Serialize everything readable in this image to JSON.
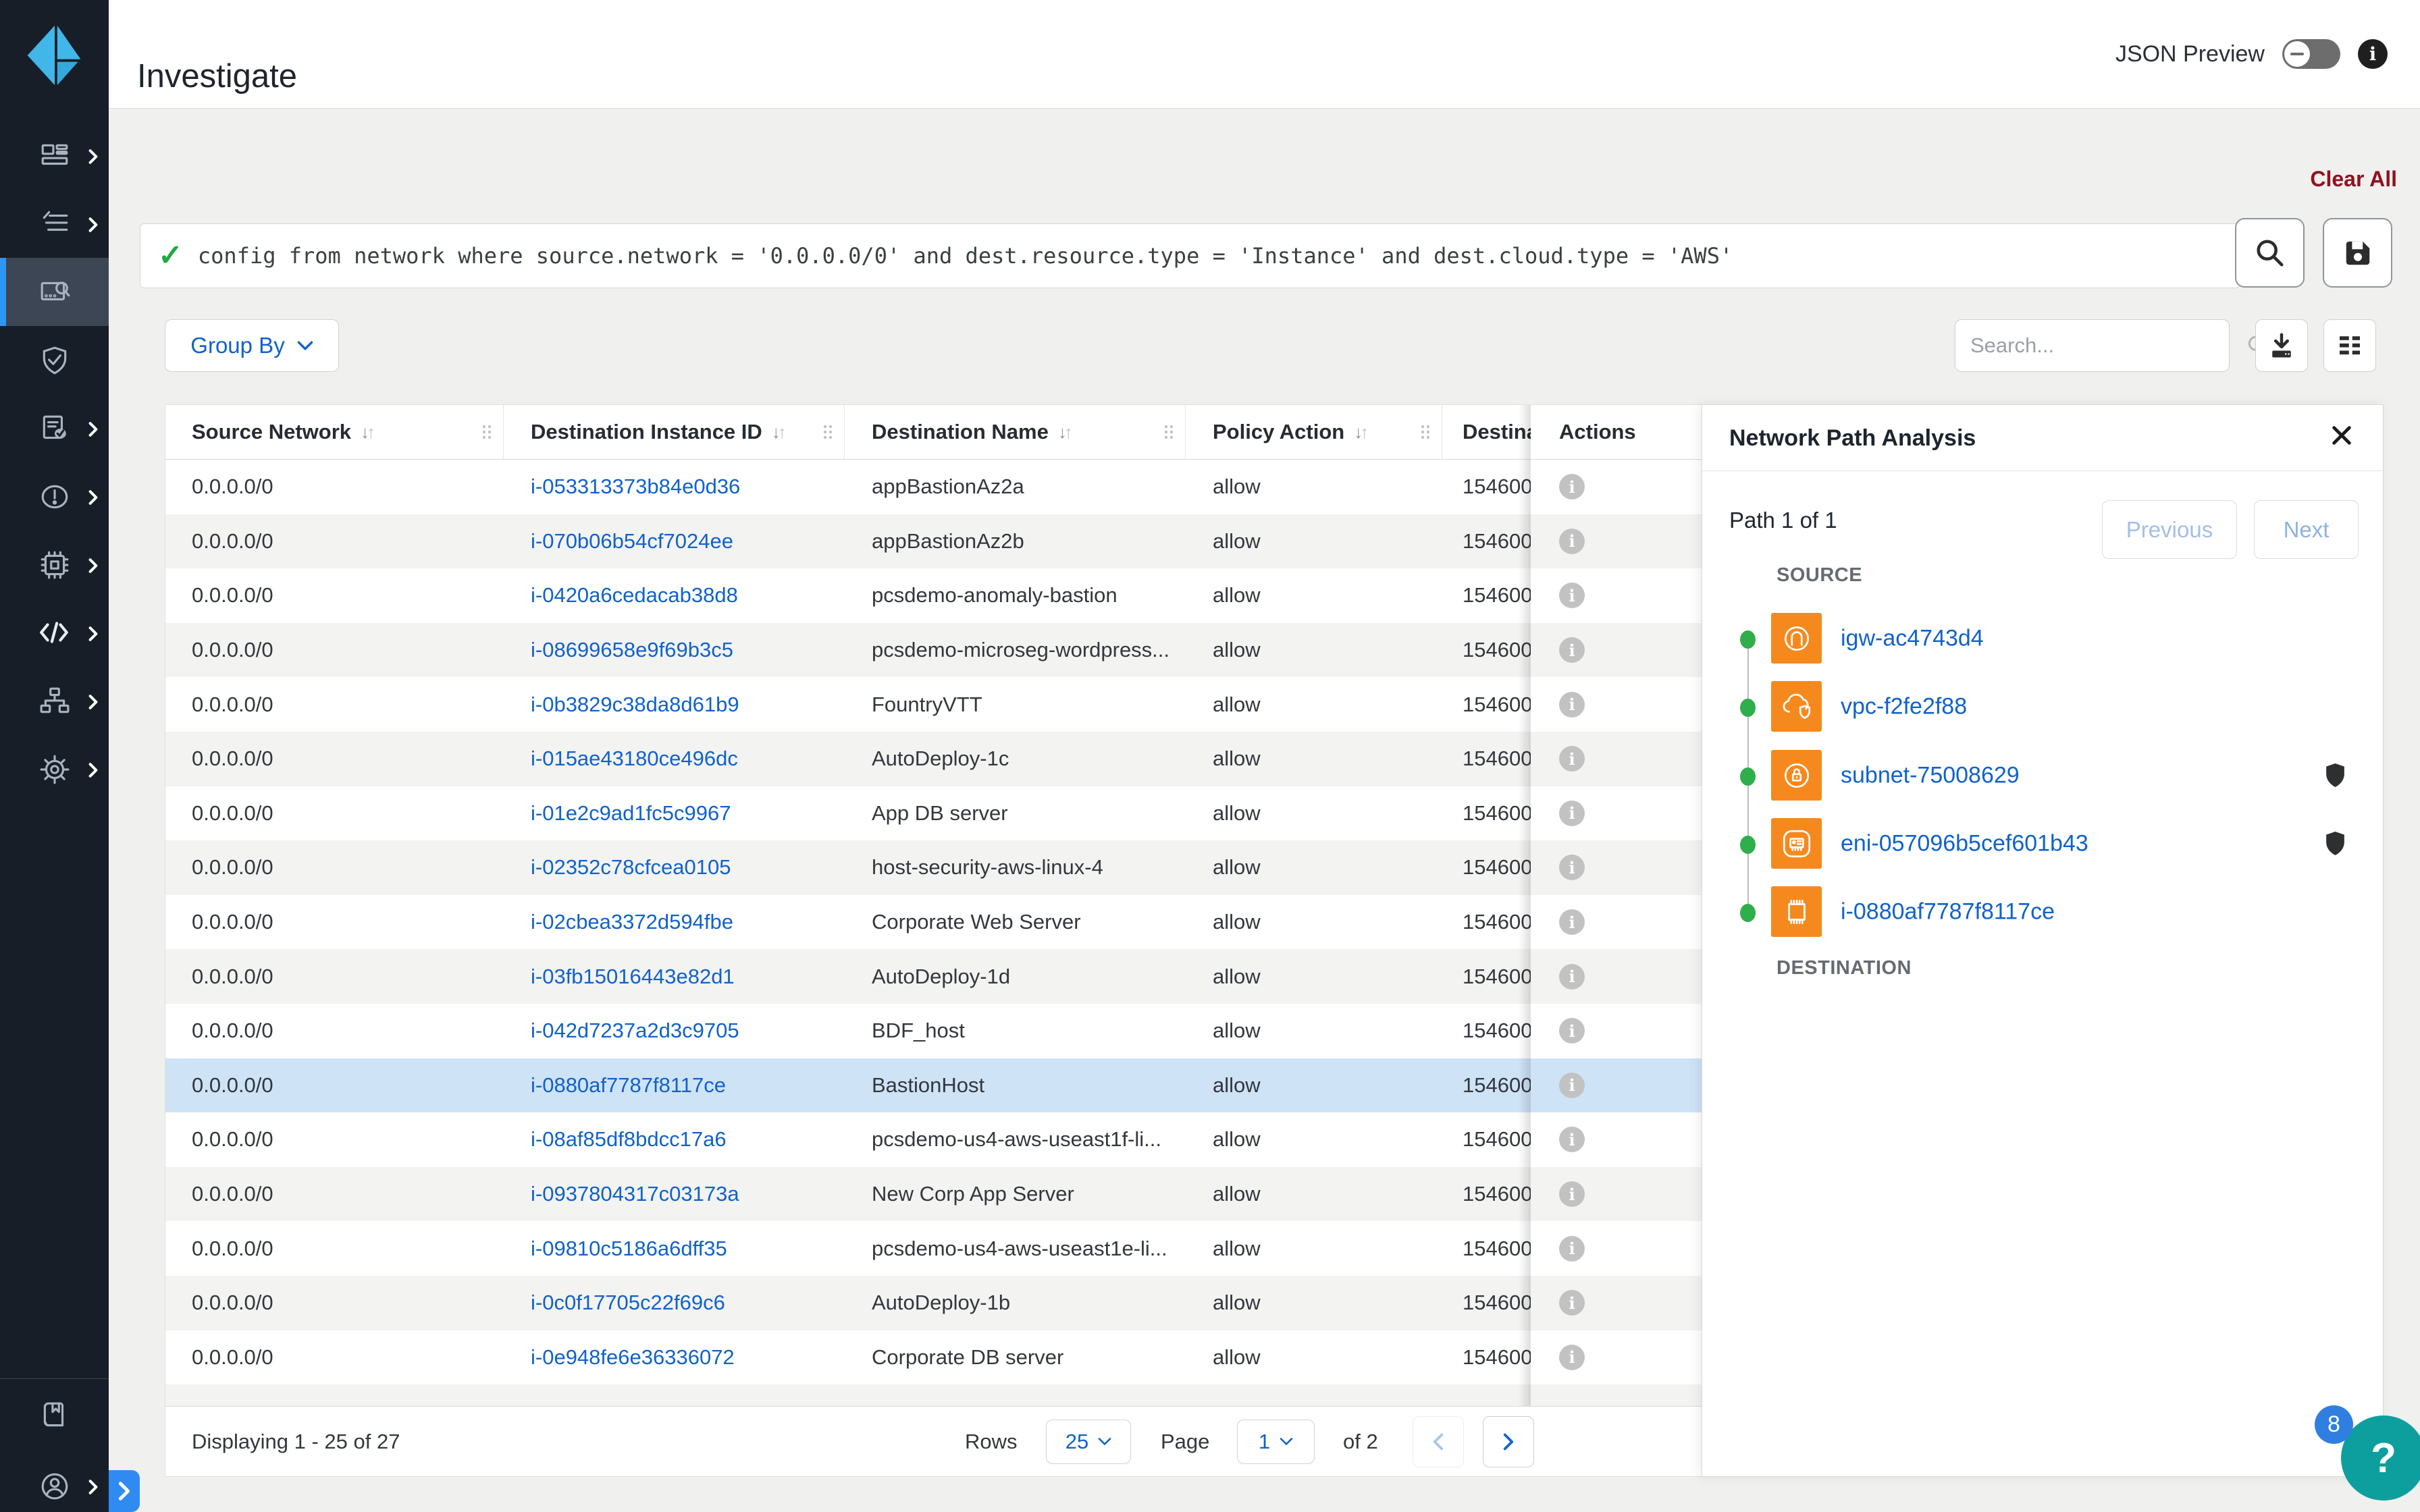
{
  "header": {
    "title": "Investigate",
    "json_preview_label": "JSON Preview"
  },
  "query": {
    "clear_all": "Clear All",
    "text": "config from network where source.network = '0.0.0.0/0' and dest.resource.type = 'Instance' and dest.cloud.type = 'AWS'"
  },
  "toolbar": {
    "group_by_label": "Group By",
    "search_placeholder": "Search..."
  },
  "sidebar": {
    "items": [
      {
        "icon": "dashboard-icon",
        "expandable": true
      },
      {
        "icon": "inventory-list-icon",
        "expandable": true
      },
      {
        "icon": "investigate-icon",
        "expandable": false,
        "selected": true
      },
      {
        "icon": "policies-shield-icon",
        "expandable": false
      },
      {
        "icon": "compliance-report-icon",
        "expandable": true
      },
      {
        "icon": "alerts-icon",
        "expandable": true
      },
      {
        "icon": "compute-chip-icon",
        "expandable": true
      },
      {
        "icon": "code-security-icon",
        "expandable": true
      },
      {
        "icon": "network-topology-icon",
        "expandable": true
      },
      {
        "icon": "settings-gear-icon",
        "expandable": true
      }
    ],
    "bottom_items": [
      {
        "icon": "docs-book-icon"
      },
      {
        "icon": "profile-user-icon",
        "expandable": true
      }
    ]
  },
  "table": {
    "columns": [
      {
        "label": "Source Network"
      },
      {
        "label": "Destination Instance ID"
      },
      {
        "label": "Destination Name"
      },
      {
        "label": "Policy Action"
      },
      {
        "label": "Destina"
      },
      {
        "label": "Actions"
      }
    ],
    "rows": [
      {
        "source": "0.0.0.0/0",
        "instance_id": "i-053313373b84e0d36",
        "name": "appBastionAz2a",
        "action": "allow",
        "dest_extra": "154600"
      },
      {
        "source": "0.0.0.0/0",
        "instance_id": "i-070b06b54cf7024ee",
        "name": "appBastionAz2b",
        "action": "allow",
        "dest_extra": "154600"
      },
      {
        "source": "0.0.0.0/0",
        "instance_id": "i-0420a6cedacab38d8",
        "name": "pcsdemo-anomaly-bastion",
        "action": "allow",
        "dest_extra": "154600"
      },
      {
        "source": "0.0.0.0/0",
        "instance_id": "i-08699658e9f69b3c5",
        "name": "pcsdemo-microseg-wordpress...",
        "action": "allow",
        "dest_extra": "154600"
      },
      {
        "source": "0.0.0.0/0",
        "instance_id": "i-0b3829c38da8d61b9",
        "name": "FountryVTT",
        "action": "allow",
        "dest_extra": "154600"
      },
      {
        "source": "0.0.0.0/0",
        "instance_id": "i-015ae43180ce496dc",
        "name": "AutoDeploy-1c",
        "action": "allow",
        "dest_extra": "154600"
      },
      {
        "source": "0.0.0.0/0",
        "instance_id": "i-01e2c9ad1fc5c9967",
        "name": "App DB server",
        "action": "allow",
        "dest_extra": "154600"
      },
      {
        "source": "0.0.0.0/0",
        "instance_id": "i-02352c78cfcea0105",
        "name": "host-security-aws-linux-4",
        "action": "allow",
        "dest_extra": "154600"
      },
      {
        "source": "0.0.0.0/0",
        "instance_id": "i-02cbea3372d594fbe",
        "name": "Corporate Web Server",
        "action": "allow",
        "dest_extra": "154600"
      },
      {
        "source": "0.0.0.0/0",
        "instance_id": "i-03fb15016443e82d1",
        "name": "AutoDeploy-1d",
        "action": "allow",
        "dest_extra": "154600"
      },
      {
        "source": "0.0.0.0/0",
        "instance_id": "i-042d7237a2d3c9705",
        "name": "BDF_host",
        "action": "allow",
        "dest_extra": "154600"
      },
      {
        "source": "0.0.0.0/0",
        "instance_id": "i-0880af7787f8117ce",
        "name": "BastionHost",
        "action": "allow",
        "dest_extra": "154600",
        "selected": true
      },
      {
        "source": "0.0.0.0/0",
        "instance_id": "i-08af85df8bdcc17a6",
        "name": "pcsdemo-us4-aws-useast1f-li...",
        "action": "allow",
        "dest_extra": "154600"
      },
      {
        "source": "0.0.0.0/0",
        "instance_id": "i-0937804317c03173a",
        "name": "New Corp App Server",
        "action": "allow",
        "dest_extra": "154600"
      },
      {
        "source": "0.0.0.0/0",
        "instance_id": "i-09810c5186a6dff35",
        "name": "pcsdemo-us4-aws-useast1e-li...",
        "action": "allow",
        "dest_extra": "154600"
      },
      {
        "source": "0.0.0.0/0",
        "instance_id": "i-0c0f17705c22f69c6",
        "name": "AutoDeploy-1b",
        "action": "allow",
        "dest_extra": "154600"
      },
      {
        "source": "0.0.0.0/0",
        "instance_id": "i-0e948fe6e36336072",
        "name": "Corporate DB server",
        "action": "allow",
        "dest_extra": "154600"
      }
    ]
  },
  "footer": {
    "displaying": "Displaying 1 - 25 of 27",
    "rows_label": "Rows",
    "rows_value": "25",
    "page_label": "Page",
    "page_value": "1",
    "of_label": "of 2"
  },
  "panel": {
    "title": "Network Path Analysis",
    "path_label": "Path 1 of 1",
    "previous_label": "Previous",
    "next_label": "Next",
    "source_label": "SOURCE",
    "destination_label": "DESTINATION",
    "nodes": [
      {
        "label": "igw-ac4743d4",
        "icon": "internet-gateway-icon",
        "shield": false
      },
      {
        "label": "vpc-f2fe2f88",
        "icon": "vpc-cloud-icon",
        "shield": false
      },
      {
        "label": "subnet-75008629",
        "icon": "subnet-lock-icon",
        "shield": true
      },
      {
        "label": "eni-057096b5cef601b43",
        "icon": "network-interface-icon",
        "shield": true
      },
      {
        "label": "i-0880af7787f8117ce",
        "icon": "instance-chip-icon",
        "shield": false
      }
    ]
  },
  "help": {
    "question_mark": "?",
    "badge": "8"
  },
  "colors": {
    "accent_blue": "#1062cb",
    "selected_row": "#cfe3f7",
    "clear_all_red": "#8e1220",
    "node_orange": "#f6891e",
    "path_dot_green": "#2fae4c",
    "sidebar_bg": "#171e27",
    "sidebar_selected": "#3c4654",
    "sidebar_accent": "#2f96f3",
    "help_teal": "#0d9f9d",
    "badge_blue": "#2f7fe0"
  }
}
